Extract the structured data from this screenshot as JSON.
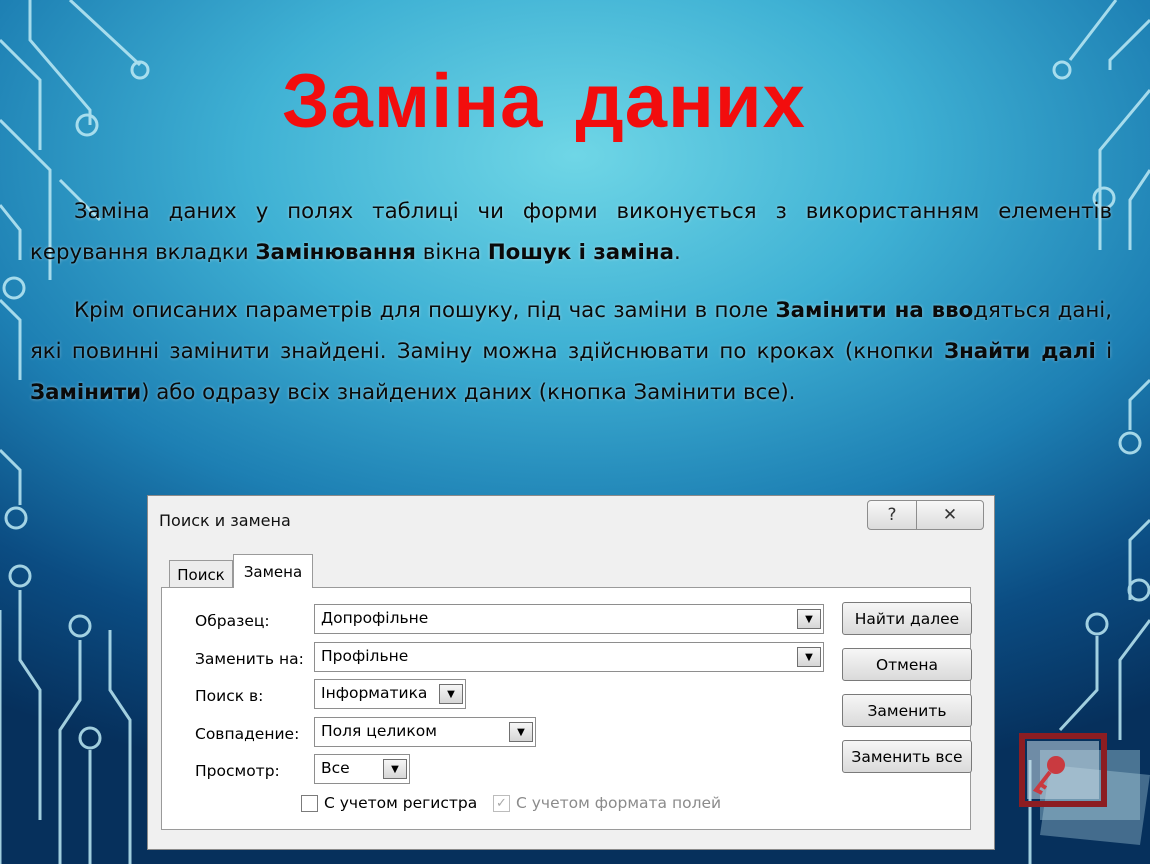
{
  "slide": {
    "title": "Заміна даних",
    "para1_parts": [
      "Заміна даних у полях таблиці чи форми виконується з використанням елементів керування вкладки ",
      "Замінювання",
      " вікна ",
      "Пошук і заміна",
      "."
    ],
    "para2_parts": [
      "Крім описаних параметрів для пошуку, під час заміни в поле ",
      "Замінити на вво",
      "дяться дані, які повинні замінити знайдені. Заміну можна здійснювати по кроках (кнопки ",
      "Знайти далі",
      " і ",
      "Замінити",
      ") або одразу всіх знайдених даних (кнопка Замінити все)."
    ]
  },
  "dialog": {
    "title": "Поиск и замена",
    "help_glyph": "?",
    "close_glyph": "✕",
    "tabs": [
      "Поиск",
      "Замена"
    ],
    "active_tab": "Замена",
    "fields": {
      "find_label": "Образец:",
      "find_value": "Допрофільне",
      "replace_label": "Заменить на:",
      "replace_value": "Профільне",
      "look_in_label": "Поиск в:",
      "look_in_value": "Інформатика",
      "match_label": "Совпадение:",
      "match_value": "Поля целиком",
      "search_label": "Просмотр:",
      "search_value": "Все"
    },
    "checkboxes": [
      {
        "label": "С учетом регистра",
        "checked": false,
        "enabled": true
      },
      {
        "label": "С учетом формата полей",
        "checked": true,
        "enabled": false
      }
    ],
    "buttons": {
      "find_next": "Найти далее",
      "cancel": "Отмена",
      "replace": "Заменить",
      "replace_all": "Заменить все"
    }
  },
  "colors": {
    "title": "#f20d0d",
    "circuit": "#bdeaf5",
    "background_center": "#6fd6e6",
    "background_edge": "#06305c"
  },
  "icons": [
    "circuit-decoration",
    "help-icon",
    "close-icon",
    "dropdown-arrow-icon",
    "checkbox-icon",
    "access-key-logo"
  ]
}
